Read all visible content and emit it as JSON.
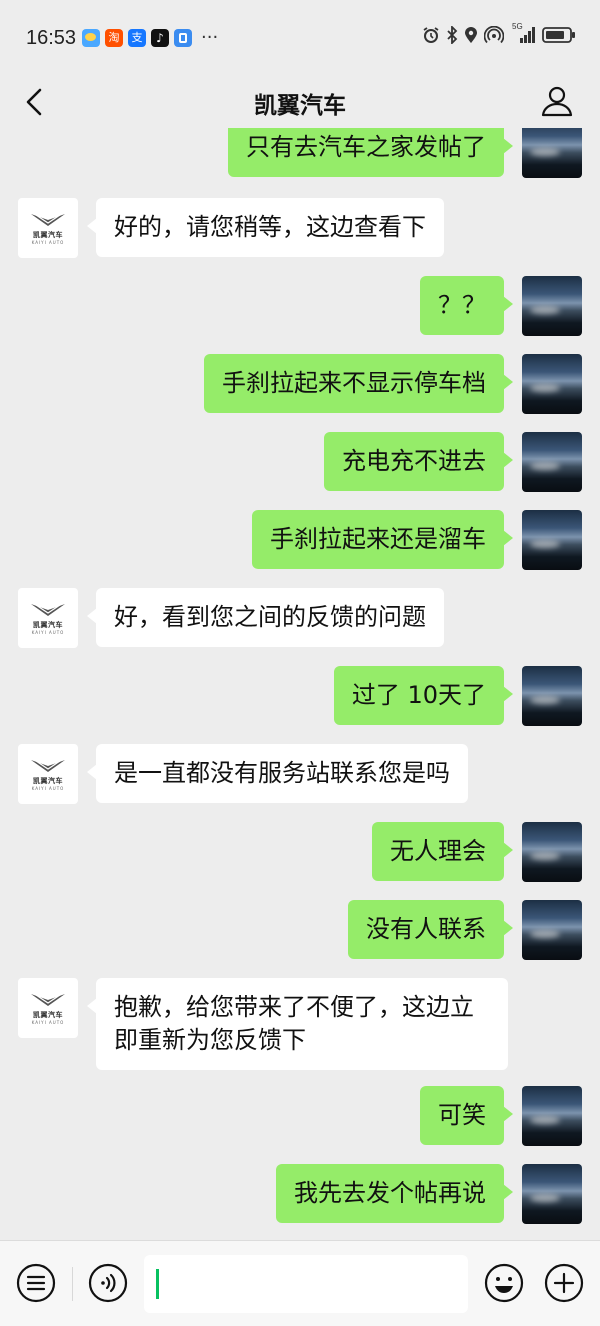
{
  "status_bar": {
    "time": "16:53",
    "app_icons": [
      "weather-icon",
      "taobao-icon",
      "alipay-icon",
      "tiktok-icon",
      "app-icon"
    ],
    "system_icons": [
      "alarm-icon",
      "bluetooth-icon",
      "location-icon",
      "hotspot-icon",
      "signal-5g-icon",
      "battery-icon"
    ],
    "network_label": "5G"
  },
  "header": {
    "title": "凯翼汽车"
  },
  "brand_logo": {
    "text": "凯翼汽车",
    "sub": "KAIYI AUTO"
  },
  "messages": [
    {
      "sender": "me",
      "text": "只有去汽车之家发帖了"
    },
    {
      "sender": "them",
      "text": "好的，请您稍等，这边查看下"
    },
    {
      "sender": "me",
      "text": "？？"
    },
    {
      "sender": "me",
      "text": "手刹拉起来不显示停车档"
    },
    {
      "sender": "me",
      "text": "充电充不进去"
    },
    {
      "sender": "me",
      "text": "手刹拉起来还是溜车"
    },
    {
      "sender": "them",
      "text": "好，看到您之间的反馈的问题"
    },
    {
      "sender": "me",
      "text": "过了 10天了"
    },
    {
      "sender": "them",
      "text": "是一直都没有服务站联系您是吗"
    },
    {
      "sender": "me",
      "text": "无人理会"
    },
    {
      "sender": "me",
      "text": "没有人联系"
    },
    {
      "sender": "them",
      "text": "抱歉，给您带来了不便了，这边立即重新为您反馈下"
    },
    {
      "sender": "me",
      "text": "可笑"
    },
    {
      "sender": "me",
      "text": "我先去发个帖再说"
    }
  ],
  "input": {
    "value": ""
  },
  "colors": {
    "background": "#ededed",
    "my_bubble": "#95ec69",
    "their_bubble": "#ffffff",
    "caret": "#07c160"
  }
}
